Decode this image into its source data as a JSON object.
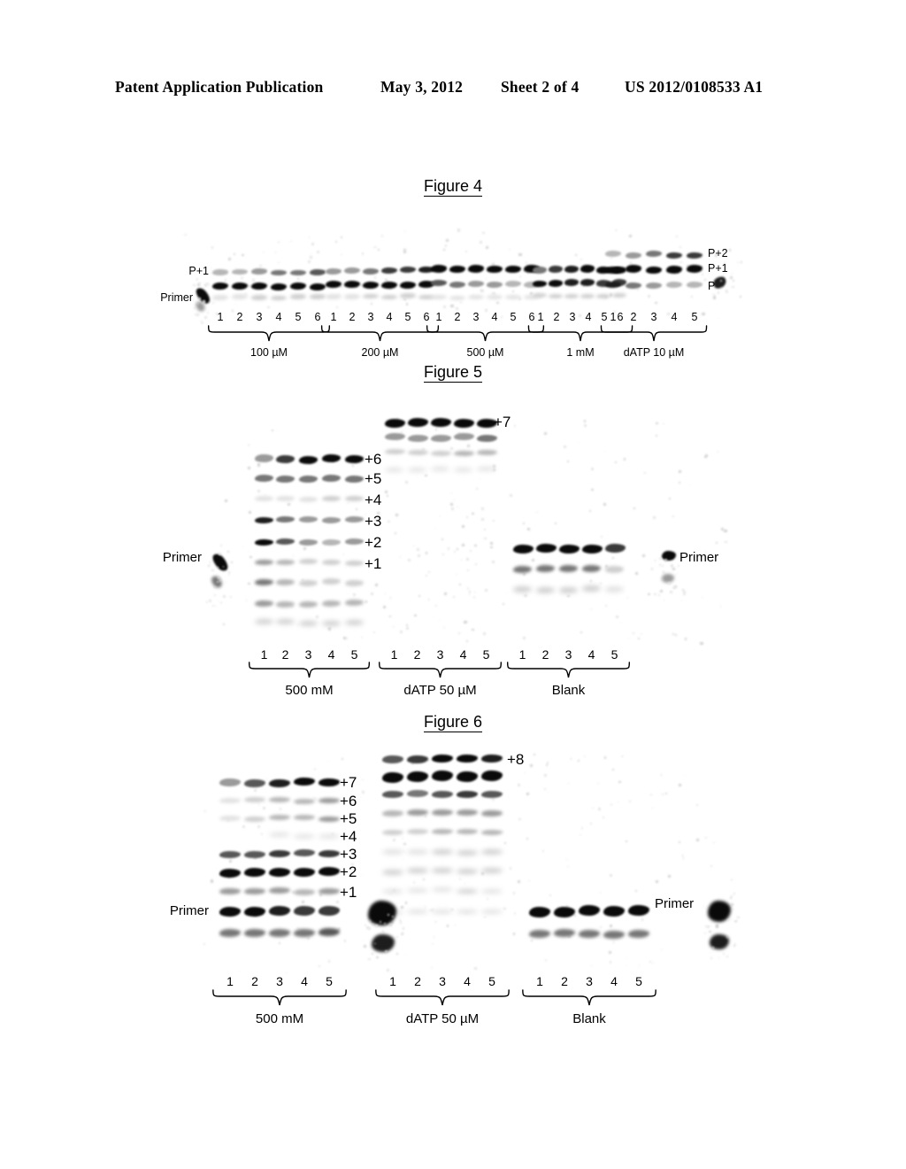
{
  "header": {
    "publication": "Patent Application Publication",
    "date": "May 3, 2012",
    "sheet": "Sheet 2 of 4",
    "number": "US 2012/0108533 A1"
  },
  "figures": [
    {
      "title": "Figure 4",
      "left_labels": [
        "P+1",
        "Primer"
      ],
      "right_labels": [
        "P+2",
        "P+1",
        "P"
      ],
      "groups": [
        {
          "label": "100 µM",
          "lanes": [
            "1",
            "2",
            "3",
            "4",
            "5",
            "6"
          ]
        },
        {
          "label": "200 µM",
          "lanes": [
            "1",
            "2",
            "3",
            "4",
            "5",
            "6"
          ]
        },
        {
          "label": "500 µM",
          "lanes": [
            "1",
            "2",
            "3",
            "4",
            "5",
            "6"
          ]
        },
        {
          "label": "1 mM",
          "lanes": [
            "1",
            "2",
            "3",
            "4",
            "5",
            "6"
          ]
        },
        {
          "label": "dATP 10 µM",
          "lanes": [
            "1",
            "2",
            "3",
            "4",
            "5"
          ]
        }
      ]
    },
    {
      "title": "Figure 5",
      "left_labels": [
        "Primer"
      ],
      "right_labels": [
        "Primer"
      ],
      "ladder": [
        "+6",
        "+5",
        "+4",
        "+3",
        "+2",
        "+1"
      ],
      "top_marker": "+7",
      "groups": [
        {
          "label": "500 mM",
          "lanes": [
            "1",
            "2",
            "3",
            "4",
            "5"
          ]
        },
        {
          "label": "dATP 50 µM",
          "lanes": [
            "1",
            "2",
            "3",
            "4",
            "5"
          ]
        },
        {
          "label": "Blank",
          "lanes": [
            "1",
            "2",
            "3",
            "4",
            "5"
          ]
        }
      ]
    },
    {
      "title": "Figure 6",
      "left_labels": [
        "Primer"
      ],
      "right_labels": [
        "Primer"
      ],
      "ladder": [
        "+7",
        "+6",
        "+5",
        "+4",
        "+3",
        "+2",
        "+1"
      ],
      "top_marker": "+8",
      "groups": [
        {
          "label": "500 mM",
          "lanes": [
            "1",
            "2",
            "3",
            "4",
            "5"
          ]
        },
        {
          "label": "dATP 50 µM",
          "lanes": [
            "1",
            "2",
            "3",
            "4",
            "5"
          ]
        },
        {
          "label": "Blank",
          "lanes": [
            "1",
            "2",
            "3",
            "4",
            "5"
          ]
        }
      ]
    }
  ]
}
